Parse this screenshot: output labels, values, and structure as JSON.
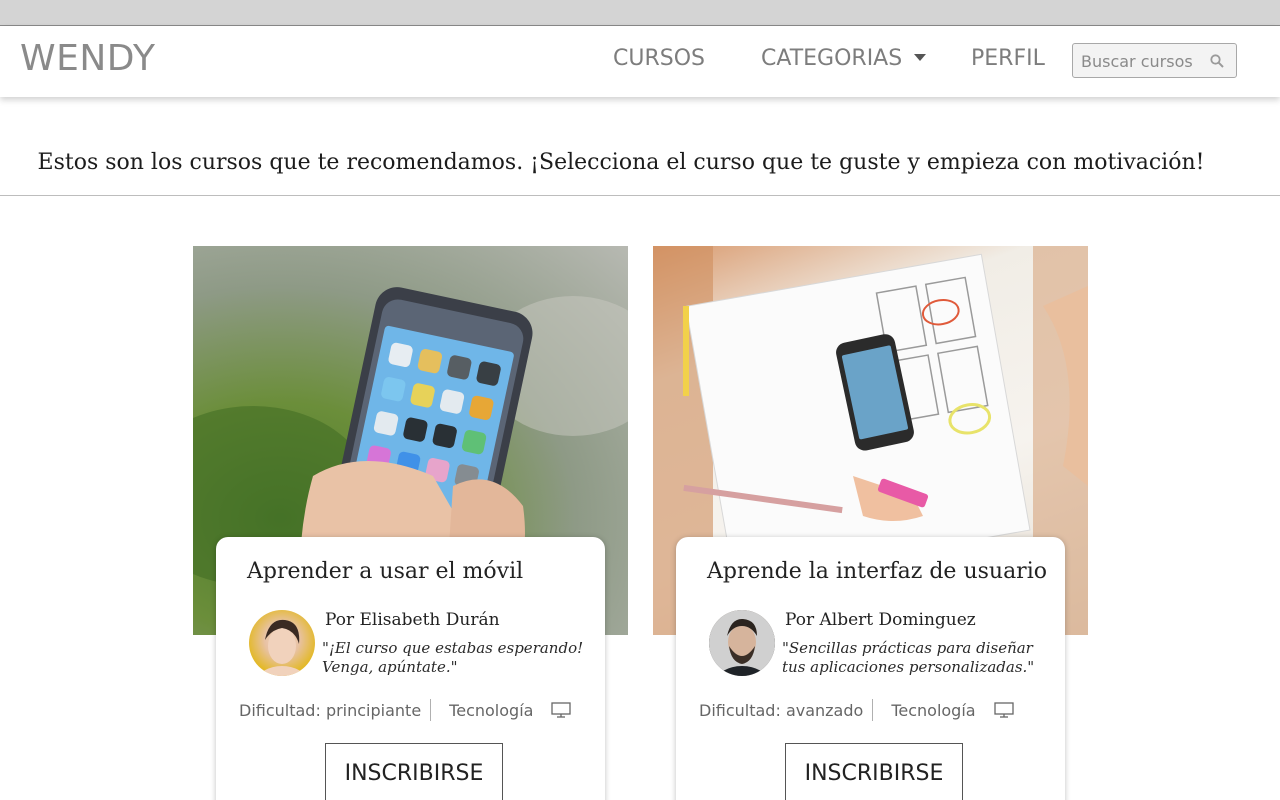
{
  "header": {
    "brand": "WENDY",
    "nav": {
      "cursos": "CURSOS",
      "categorias": "CATEGORIAS",
      "perfil": "PERFIL"
    },
    "search": {
      "placeholder": "Buscar cursos",
      "icon": "search-icon"
    }
  },
  "main": {
    "tagline": "Estos son los cursos que te recomendamos. ¡Selecciona el curso que te guste y empieza con motivación!"
  },
  "courses": [
    {
      "title": "Aprender a usar el móvil",
      "author": "Por Elisabeth Durán",
      "quote": "\"¡El curso que estabas esperando! Venga, apúntate.\"",
      "difficulty": "Dificultad: principiante",
      "category": "Tecnología",
      "category_icon": "monitor-icon",
      "button": "INSCRIBIRSE"
    },
    {
      "title": "Aprende la interfaz de usuario",
      "author": "Por Albert Dominguez",
      "quote": "\"Sencillas prácticas para diseñar tus aplicaciones personalizadas.\"",
      "difficulty": "Dificultad: avanzado",
      "category": "Tecnología",
      "category_icon": "monitor-icon",
      "button": "INSCRIBIRSE"
    }
  ],
  "colors": {
    "brand": "#8a8a8a",
    "nav_text": "#7d7d7d",
    "top_strip": "#d4d4d4"
  }
}
